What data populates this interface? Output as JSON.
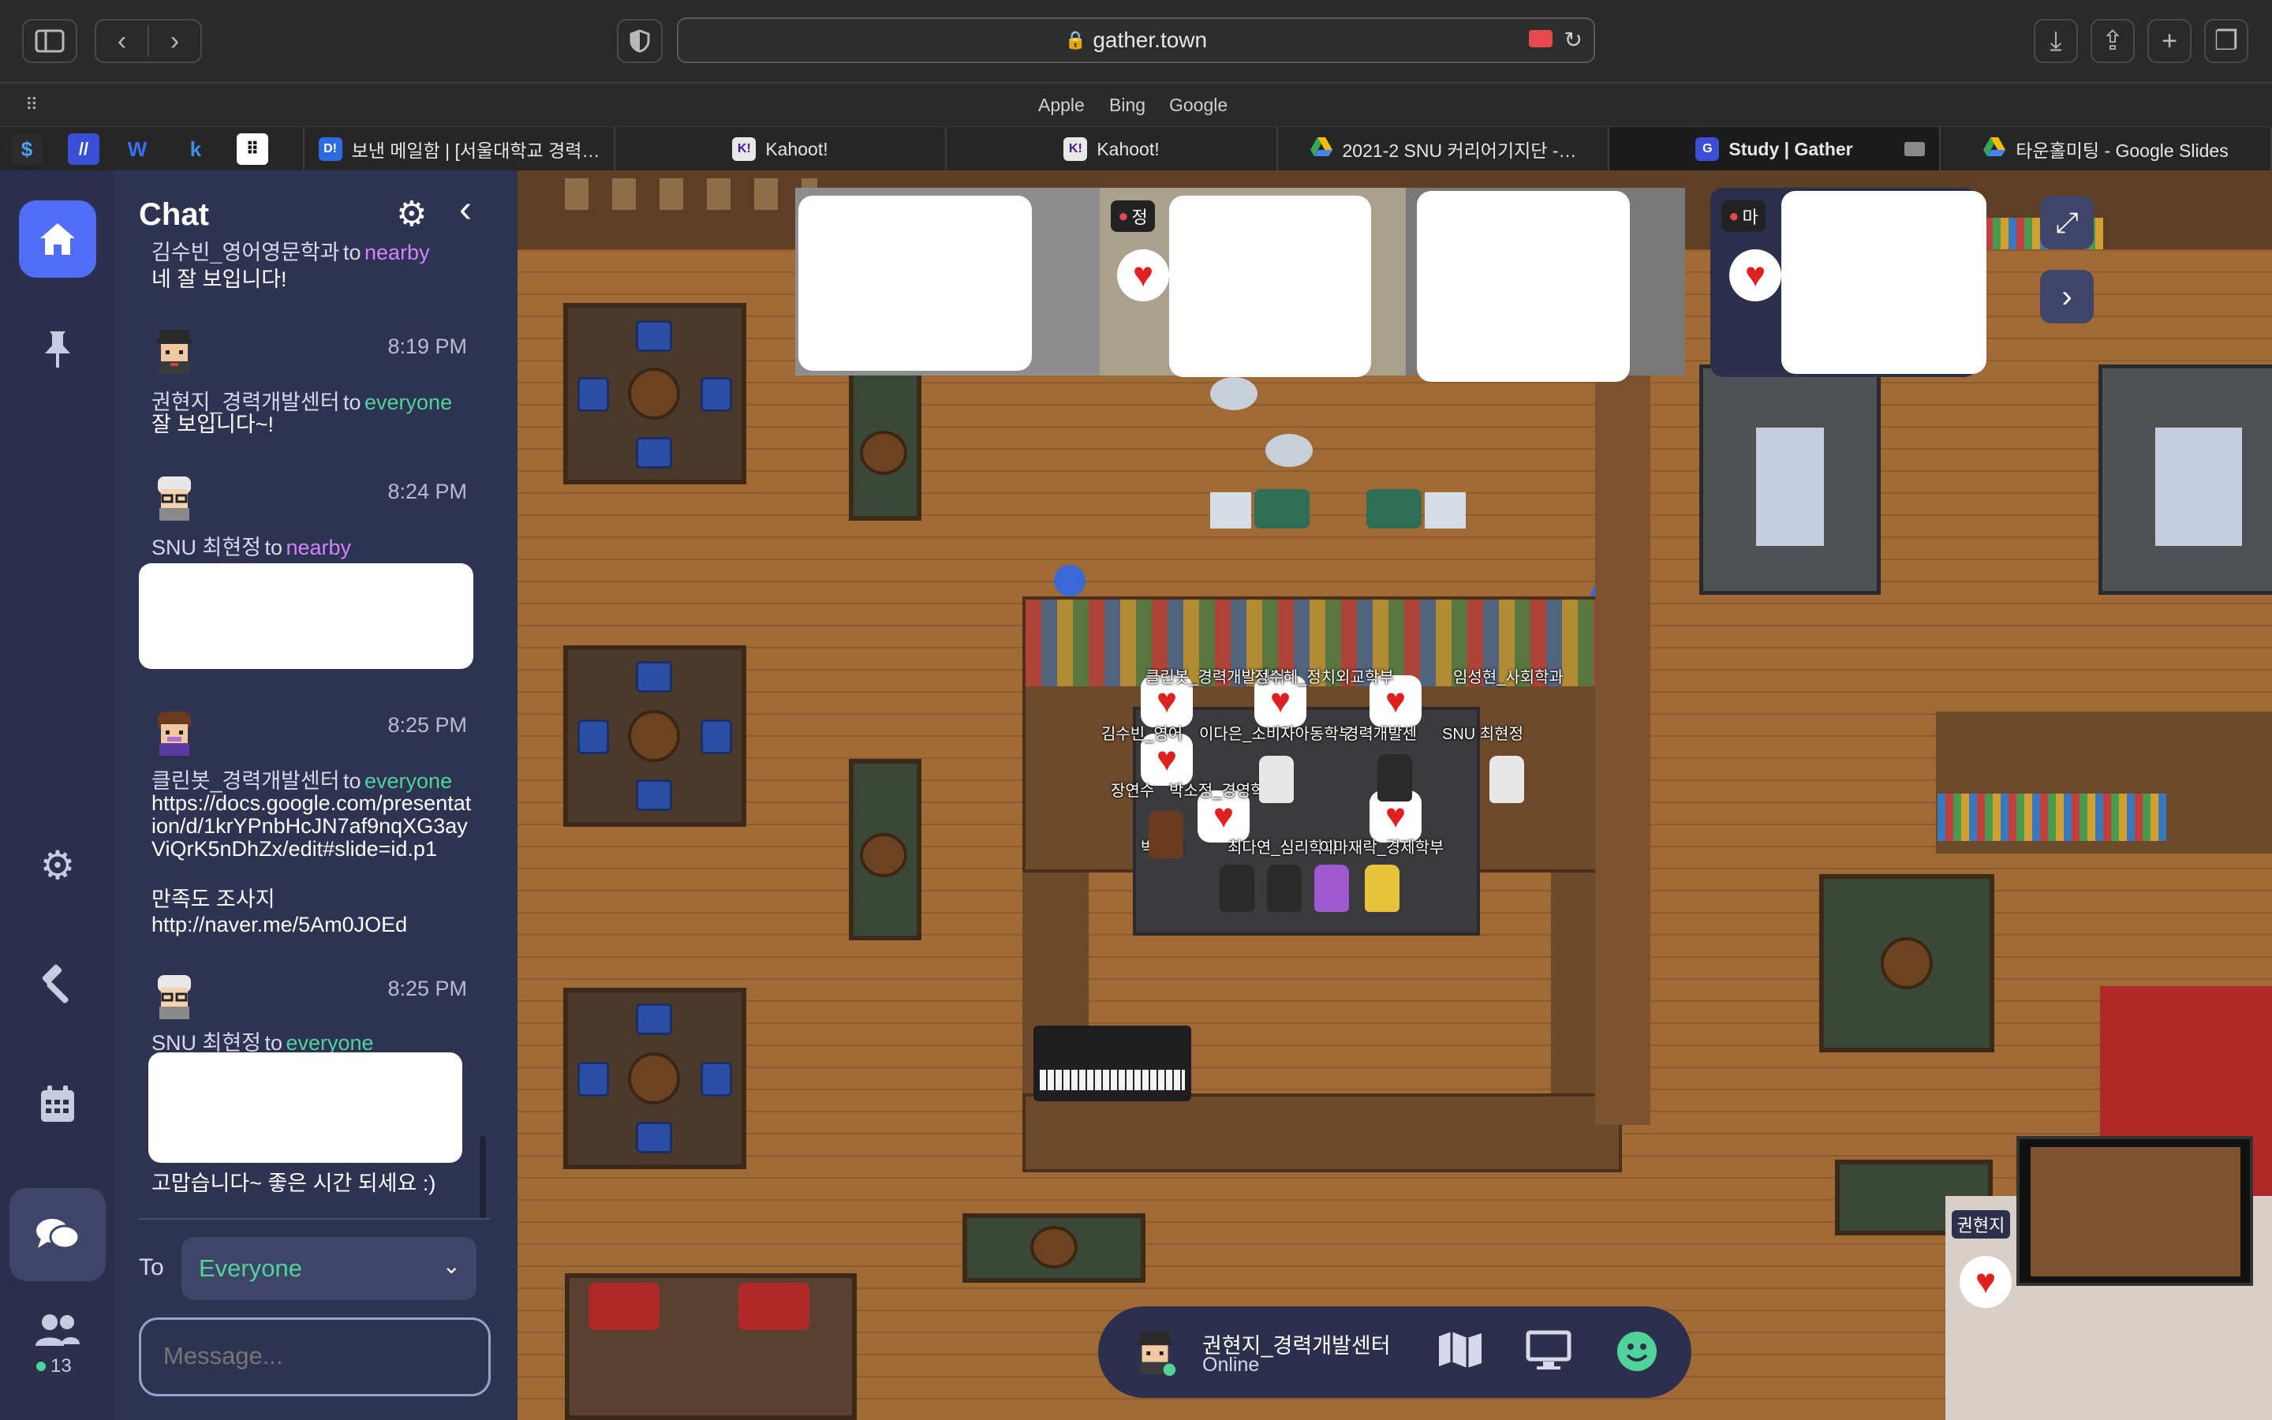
{
  "browser": {
    "url": "gather.town",
    "favorites": [
      "Apple",
      "Bing",
      "Google"
    ],
    "tabs": [
      {
        "label": "보낸 메일함 | [서울대학교 경력…",
        "icon": "D!"
      },
      {
        "label": "Kahoot!",
        "icon": "K!"
      },
      {
        "label": "Kahoot!",
        "icon": "K!"
      },
      {
        "label": "2021-2 SNU 커리어기지단 -…",
        "icon": "drive"
      },
      {
        "label": "Study | Gather",
        "icon": "gather"
      },
      {
        "label": "타운홀미팅 - Google Slides",
        "icon": "drive"
      }
    ]
  },
  "colors": {
    "rail": "#2c304d",
    "chat": "#2e3352",
    "accent": "#4f6ef5",
    "everyone": "#4fd39a",
    "nearby": "#d283ff"
  },
  "chat": {
    "title": "Chat",
    "messages": [
      {
        "name": "김수빈_영어영문학과",
        "to_word": "to",
        "to": "nearby",
        "text": "네 잘 보입니다!"
      },
      {
        "time": "8:19 PM",
        "name": "권현지_경력개발센터",
        "to_word": "to",
        "to": "everyone",
        "text": "잘 보입니다~!"
      },
      {
        "time": "8:24 PM",
        "name": "SNU 최현정",
        "to_word": "to",
        "to": "nearby"
      },
      {
        "time": "8:25 PM",
        "name": "클린봇_경력개발센터",
        "to_word": "to",
        "to": "everyone",
        "text": "https://docs.google.com/presentation/d/1krYPnbHcJN7af9nqXG3ayViQrK5nDhZx/edit#slide=id.p1",
        "text2": "만족도 조사지",
        "text3": "http://naver.me/5Am0JOEd"
      },
      {
        "time": "8:25 PM",
        "name": "SNU 최현정",
        "to_word": "to",
        "to": "everyone",
        "text": "고맙습니다~ 좋은 시간 되세요 :)"
      }
    ],
    "to_label": "To",
    "recipient": "Everyone",
    "message_placeholder": "Message...",
    "online_count": "13"
  },
  "map": {
    "video_labels": [
      "정",
      "마"
    ],
    "name_tags": [
      "클린봇_경력개발센터",
      "정수혜_정치외교학부",
      "임성현_사회학과",
      "김수빈_영어",
      "이다은_소비자아동학부",
      "경력개발센",
      "SNU 최현정",
      "장연수",
      "박소정_경영학과",
      "박은빈",
      "최다연_심리학과",
      "이마재락_경제학부"
    ]
  },
  "user": {
    "name": "권현지_경력개발센터",
    "status": "Online"
  },
  "mini_video_label": "권현지"
}
